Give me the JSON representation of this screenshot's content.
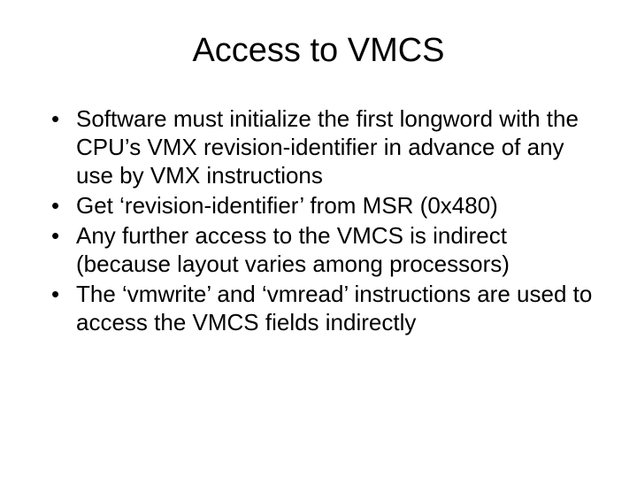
{
  "slide": {
    "title": "Access to VMCS",
    "bullets": [
      "Software must initialize the first longword with the CPU’s VMX revision-identifier in advance of any use by VMX instructions",
      "Get ‘revision-identifier’ from MSR (0x480)",
      "Any further access to the VMCS is indirect (because layout varies among processors)",
      "The ‘vmwrite’ and ‘vmread’ instructions are used to access the VMCS fields indirectly"
    ]
  }
}
